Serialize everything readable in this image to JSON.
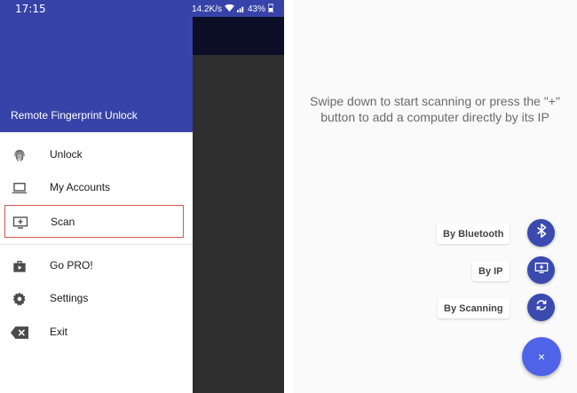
{
  "status_bar": {
    "time": "17:15",
    "speed": "14.2K/s",
    "battery": "43%"
  },
  "drawer": {
    "title": "Remote Fingerprint Unlock",
    "items": [
      {
        "label": "Unlock",
        "icon": "fingerprint-icon"
      },
      {
        "label": "My Accounts",
        "icon": "laptop-icon"
      },
      {
        "label": "Scan",
        "icon": "add-to-queue-icon",
        "selected": true
      },
      {
        "label": "Go PRO!",
        "icon": "shop-icon"
      },
      {
        "label": "Settings",
        "icon": "gear-icon"
      },
      {
        "label": "Exit",
        "icon": "backspace-icon"
      }
    ]
  },
  "main": {
    "empty_message_line1": "Swipe down to start scanning or press the \"+\"",
    "empty_message_line2": "button to add a computer directly by its IP",
    "fab_actions": [
      {
        "label": "By Bluetooth",
        "icon": "bluetooth-icon"
      },
      {
        "label": "By IP",
        "icon": "add-to-queue-icon"
      },
      {
        "label": "By Scanning",
        "icon": "refresh-icon"
      }
    ],
    "main_fab_icon": "close-icon",
    "main_fab_glyph": "×"
  },
  "colors": {
    "primary": "#3743a8",
    "fab": "#4e63e8",
    "mini_fab": "#3a4aaf",
    "highlight": "#d9534f"
  }
}
